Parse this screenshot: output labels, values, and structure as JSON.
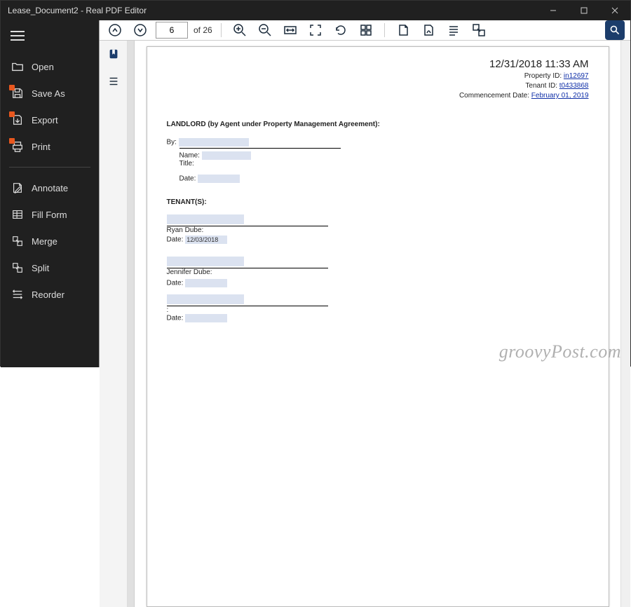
{
  "window": {
    "title": "Lease_Document2 - Real PDF Editor"
  },
  "sidebar": {
    "items": [
      {
        "label": "Open"
      },
      {
        "label": "Save As"
      },
      {
        "label": "Export"
      },
      {
        "label": "Print"
      },
      {
        "label": "Annotate"
      },
      {
        "label": "Fill Form"
      },
      {
        "label": "Merge"
      },
      {
        "label": "Split"
      },
      {
        "label": "Reorder"
      }
    ]
  },
  "toolbar": {
    "page_current": "6",
    "page_total_label": "of 26"
  },
  "doc": {
    "timestamp": "12/31/2018 11:33 AM",
    "property_id_label": "Property ID:",
    "property_id": "in12697",
    "tenant_id_label": "Tenant ID:",
    "tenant_id": "t0433868",
    "commence_label": "Commencement Date:",
    "commence_value": "February 01, 2019",
    "landlord_heading": "LANDLORD (by Agent under Property Management Agreement):",
    "by_label": "By:",
    "name_label": "Name:",
    "title_label": "Title:",
    "date_label": "Date:",
    "tenants_heading": "TENANT(S):",
    "sig1_name": "Ryan Dube:",
    "sig1_date_value": "12/03/2018",
    "sig2_name": "Jennifer Dube:",
    "sig3_name": ":"
  },
  "watermark": "groovyPost.com"
}
